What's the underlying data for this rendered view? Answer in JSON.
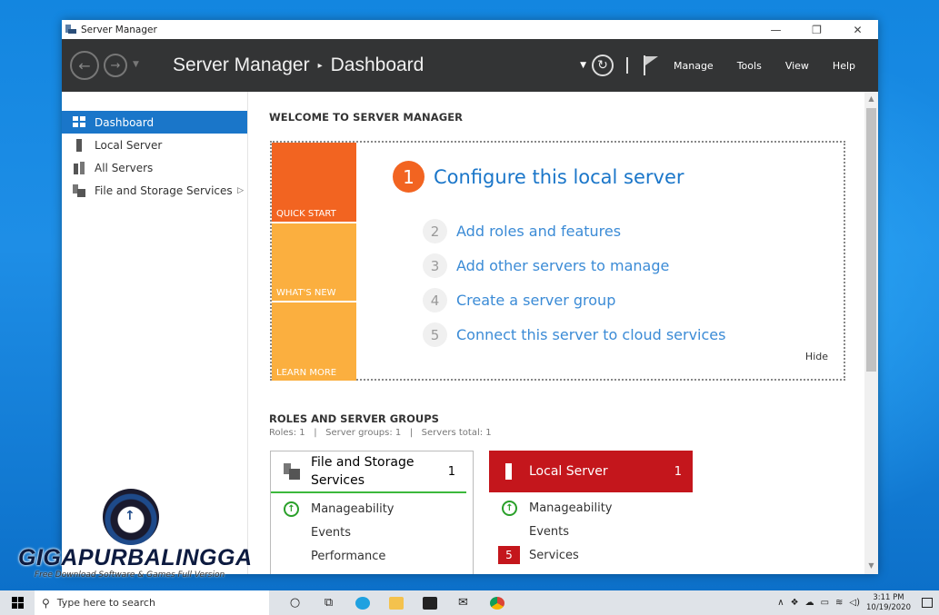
{
  "window": {
    "title": "Server Manager",
    "controls": {
      "minimize": "—",
      "restore": "❐",
      "close": "✕"
    }
  },
  "header": {
    "breadcrumb_root": "Server Manager",
    "breadcrumb_sep": "▸",
    "breadcrumb_page": "Dashboard",
    "menus": [
      "Manage",
      "Tools",
      "View",
      "Help"
    ]
  },
  "sidebar": {
    "items": [
      {
        "label": "Dashboard",
        "icon": "dashboard-icon"
      },
      {
        "label": "Local Server",
        "icon": "server-icon"
      },
      {
        "label": "All Servers",
        "icon": "servers-icon"
      },
      {
        "label": "File and Storage Services",
        "icon": "file-storage-icon"
      }
    ]
  },
  "welcome": {
    "title": "WELCOME TO SERVER MANAGER",
    "tiles": [
      "QUICK START",
      "WHAT'S NEW",
      "LEARN MORE"
    ],
    "steps": [
      {
        "num": "1",
        "label": "Configure this local server"
      },
      {
        "num": "2",
        "label": "Add roles and features"
      },
      {
        "num": "3",
        "label": "Add other servers to manage"
      },
      {
        "num": "4",
        "label": "Create a server group"
      },
      {
        "num": "5",
        "label": "Connect this server to cloud services"
      }
    ],
    "hide": "Hide"
  },
  "roles": {
    "title": "ROLES AND SERVER GROUPS",
    "summary": "Roles: 1   |   Server groups: 1   |   Servers total: 1",
    "cards": [
      {
        "title": "File and Storage Services",
        "count": "1",
        "rows": [
          "Manageability",
          "Events",
          "Performance"
        ]
      },
      {
        "title": "Local Server",
        "count": "1",
        "rows": [
          "Manageability",
          "Events",
          "Services"
        ],
        "services_badge": "5",
        "accent": "#c4161c"
      }
    ]
  },
  "watermark": {
    "brand": "GIGAPURBALINGGA",
    "tagline": "Free Download Software & Games Full Version"
  },
  "taskbar": {
    "search_placeholder": "Type here to search",
    "time": "3:11 PM",
    "date": "10/19/2020"
  },
  "colors": {
    "accent_blue": "#1a76c9",
    "quick_start_orange": "#f26421",
    "tile_yellow": "#fbaf3f",
    "header_dark": "#333435"
  }
}
